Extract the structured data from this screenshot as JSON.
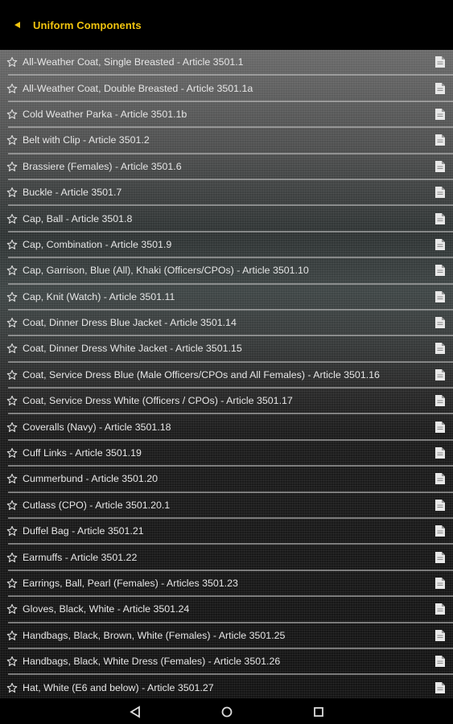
{
  "app_bar": {
    "title": "Uniform Components",
    "back_icon": "back-arrow-icon"
  },
  "colors": {
    "accent": "#f1c40f",
    "row_text": "#e6e6e6",
    "divider": "#c8c8c8"
  },
  "list": {
    "items": [
      {
        "label": "All-Weather Coat, Single Breasted - Article 3501.1"
      },
      {
        "label": "All-Weather Coat, Double Breasted - Article 3501.1a"
      },
      {
        "label": "Cold Weather Parka - Article 3501.1b"
      },
      {
        "label": "Belt with Clip - Article 3501.2"
      },
      {
        "label": "Brassiere (Females) - Article 3501.6"
      },
      {
        "label": "Buckle - Article 3501.7"
      },
      {
        "label": "Cap, Ball - Article 3501.8"
      },
      {
        "label": "Cap, Combination - Article 3501.9"
      },
      {
        "label": "Cap, Garrison, Blue (All), Khaki (Officers/CPOs) - Article 3501.10"
      },
      {
        "label": "Cap, Knit (Watch) - Article 3501.11"
      },
      {
        "label": "Coat, Dinner Dress Blue Jacket - Article 3501.14"
      },
      {
        "label": "Coat, Dinner Dress White Jacket - Article 3501.15"
      },
      {
        "label": "Coat, Service Dress Blue (Male Officers/CPOs and All Females) - Article 3501.16"
      },
      {
        "label": "Coat, Service Dress White (Officers / CPOs) - Article 3501.17"
      },
      {
        "label": "Coveralls (Navy) - Article 3501.18"
      },
      {
        "label": "Cuff Links - Article 3501.19"
      },
      {
        "label": "Cummerbund - Article 3501.20"
      },
      {
        "label": "Cutlass (CPO) - Article 3501.20.1"
      },
      {
        "label": "Duffel Bag - Article 3501.21"
      },
      {
        "label": "Earmuffs - Article 3501.22"
      },
      {
        "label": "Earrings, Ball, Pearl (Females) - Articles 3501.23"
      },
      {
        "label": "Gloves, Black, White - Article 3501.24"
      },
      {
        "label": "Handbags, Black, Brown, White (Females) - Article 3501.25"
      },
      {
        "label": "Handbags, Black, White Dress (Females) - Article 3501.26"
      },
      {
        "label": "Hat, White (E6 and below) - Article 3501.27"
      }
    ]
  },
  "nav_bar": {
    "back_icon": "nav-back-icon",
    "home_icon": "nav-home-icon",
    "recents_icon": "nav-recents-icon"
  }
}
